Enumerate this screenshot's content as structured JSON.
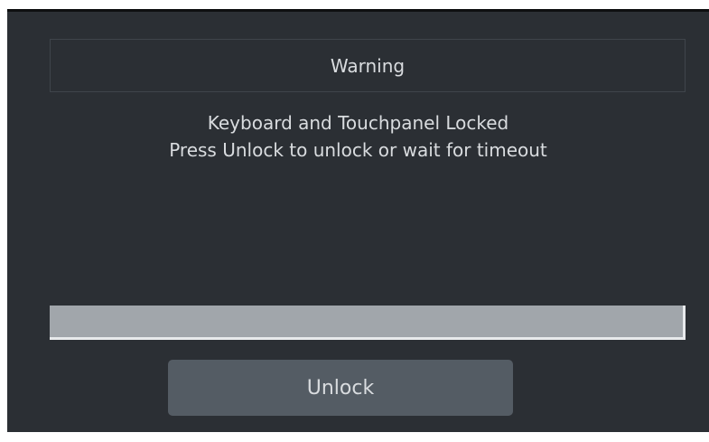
{
  "dialog": {
    "title": "Warning",
    "message_line1": "Keyboard and Touchpanel Locked",
    "message_line2": "Press Unlock to unlock or wait for timeout",
    "progress_fraction": 1.0,
    "unlock_label": "Unlock"
  },
  "colors": {
    "background": "#2b2f34",
    "text": "#d9dcdf",
    "button": "#545c64",
    "progress": "#a1a6ab"
  }
}
